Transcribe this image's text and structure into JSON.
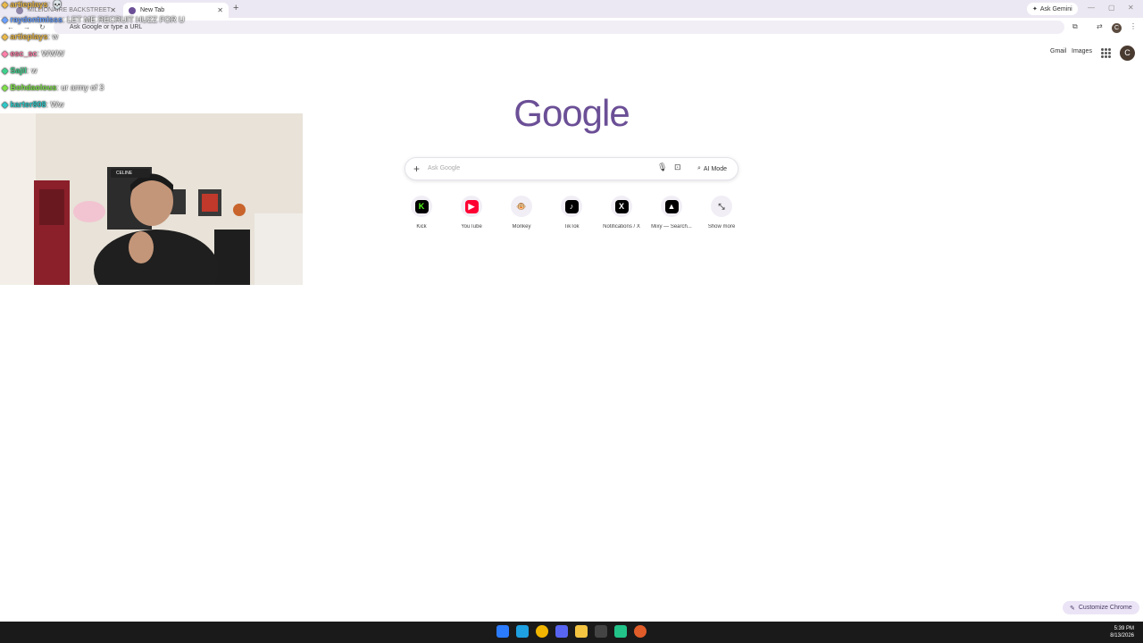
{
  "browser": {
    "tabs": [
      {
        "label": "MILLIONAIRE BACKSTREET"
      },
      {
        "label": "New Tab"
      }
    ],
    "new_tab_label": "+",
    "ask_gemini": "Ask Gemini",
    "omnibox_placeholder": "Ask Google or type a URL",
    "profile_initial": "C"
  },
  "ntp": {
    "top_links": [
      "Gmail",
      "Images"
    ],
    "avatar_initial": "C",
    "logo_text": "Google",
    "search_placeholder": "Ask Google",
    "ai_mode_label": "AI Mode",
    "shortcuts": [
      {
        "label": "Kick",
        "glyph": "K",
        "color": "#53fc18",
        "bg": "#000000"
      },
      {
        "label": "YouTube",
        "glyph": "▶",
        "color": "#ffffff",
        "bg": "#ff0033"
      },
      {
        "label": "Monkey",
        "glyph": "🐵",
        "color": "#8a5a2b",
        "bg": "#f1eef6"
      },
      {
        "label": "TikTok",
        "glyph": "♪",
        "color": "#ffffff",
        "bg": "#000000"
      },
      {
        "label": "Notifications / X",
        "glyph": "X",
        "color": "#ffffff",
        "bg": "#000000"
      },
      {
        "label": "Mixy — Search...",
        "glyph": "▲",
        "color": "#ffffff",
        "bg": "#000000"
      },
      {
        "label": "Show more",
        "glyph": "⤡",
        "color": "#555555",
        "bg": "#f1eef6"
      }
    ],
    "customize_label": "Customize Chrome"
  },
  "chat_overlay": [
    {
      "user": "artieplays",
      "message": ": 💀",
      "color": "#e8b84a"
    },
    {
      "user": "raydontmisss",
      "message": ": LET ME RECRUIT HUZZ FOR U",
      "color": "#6aa0ff"
    },
    {
      "user": "artieplays",
      "message": ": w",
      "color": "#e8b84a"
    },
    {
      "user": "esc_sc",
      "message": ": WWW",
      "color": "#ff7fa8"
    },
    {
      "user": "Sajil",
      "message": ": w",
      "color": "#3fd18c"
    },
    {
      "user": "Bohdaolous",
      "message": ": ur army of 3",
      "color": "#7ee04a"
    },
    {
      "user": "karter808",
      "message": ": Ww",
      "color": "#30c7c7"
    }
  ],
  "webcam_badge": "CELINE",
  "taskbar": {
    "time": "5:39 PM",
    "date": "8/13/2026",
    "icons": [
      {
        "name": "windows-start-icon",
        "color": "#2b7bff"
      },
      {
        "name": "edge-icon",
        "color": "#1fa0e0"
      },
      {
        "name": "chrome-icon",
        "color": "#f2b600"
      },
      {
        "name": "discord-icon",
        "color": "#5865f2"
      },
      {
        "name": "file-explorer-icon",
        "color": "#f5c542"
      },
      {
        "name": "obs-icon",
        "color": "#444444"
      },
      {
        "name": "app-icon",
        "color": "#22c48a"
      },
      {
        "name": "chrome-canary-icon",
        "color": "#e05d2a"
      }
    ]
  },
  "colors": {
    "accent": "#6b4f96",
    "tabbar_bg": "#ece8f3"
  }
}
